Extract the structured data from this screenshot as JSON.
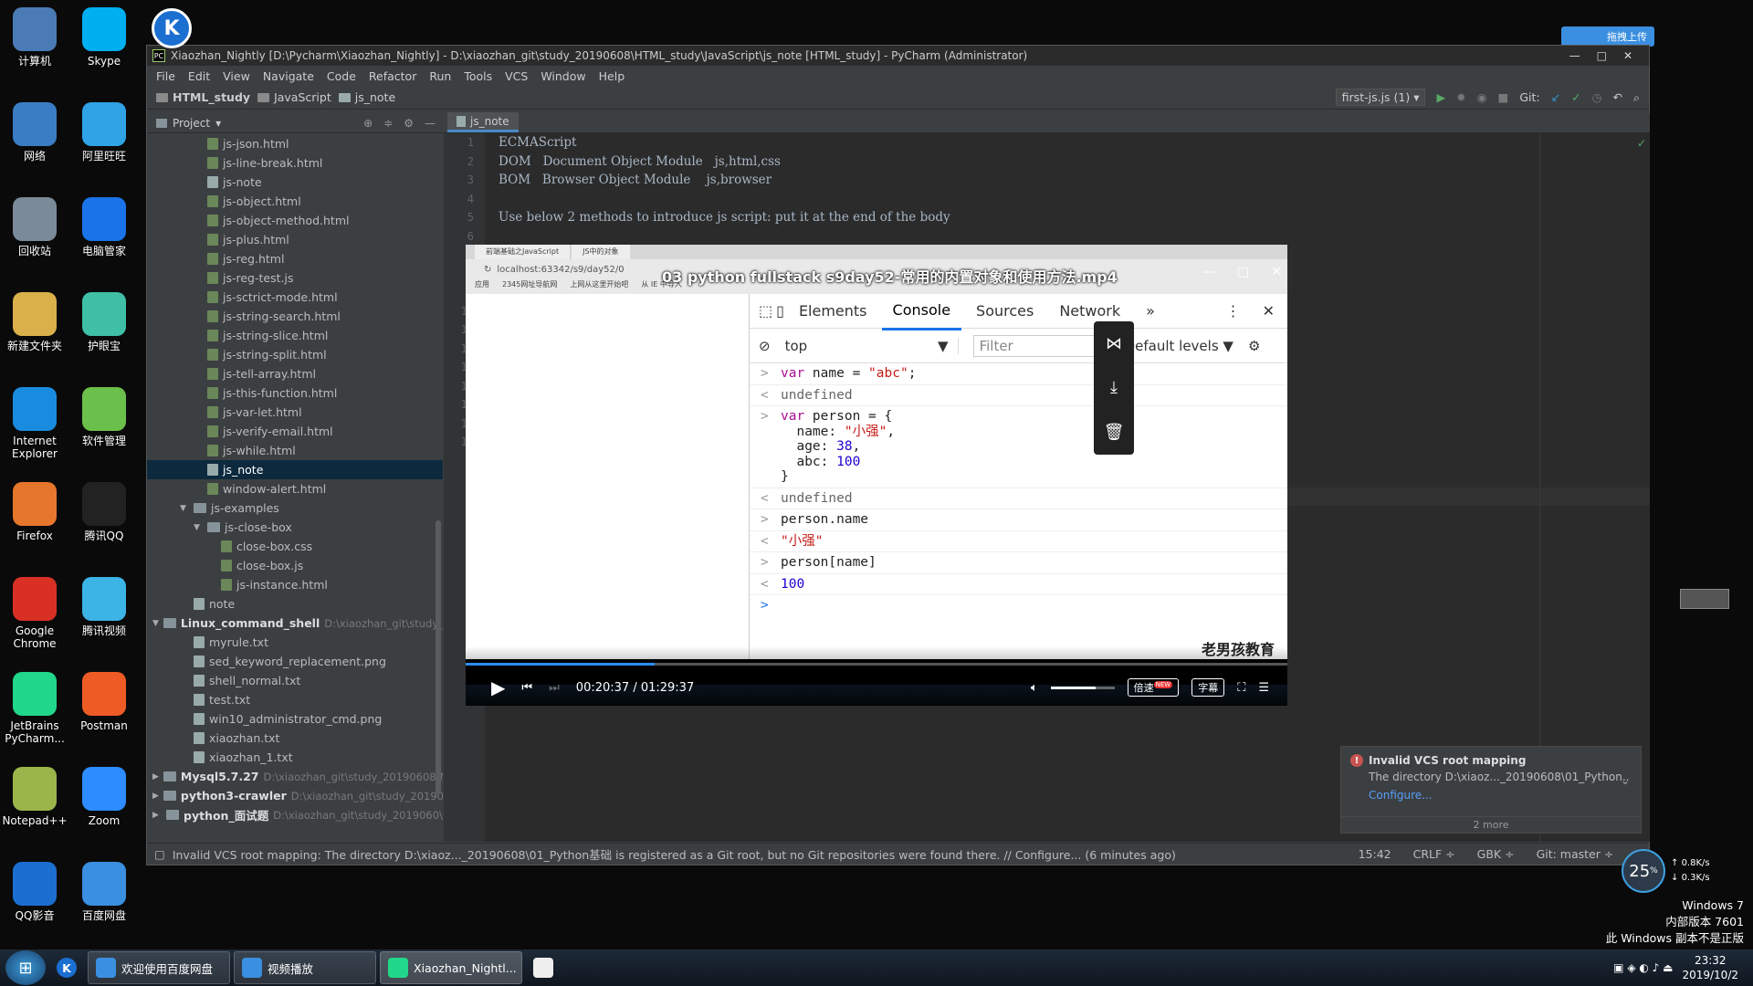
{
  "desktop": {
    "icons": [
      {
        "label": "计算机",
        "icon": "computer-icon",
        "color": "#4a7bb5"
      },
      {
        "label": "Skype",
        "icon": "skype-icon",
        "color": "#00aff0"
      },
      {
        "label": "网络",
        "icon": "network-icon",
        "color": "#3b7dc4"
      },
      {
        "label": "阿里旺旺",
        "icon": "aliwangwang-icon",
        "color": "#2fa3e6"
      },
      {
        "label": "回收站",
        "icon": "recycle-bin-icon",
        "color": "#7a8a99"
      },
      {
        "label": "电脑管家",
        "icon": "pc-manager-icon",
        "color": "#1a73e8"
      },
      {
        "label": "新建文件夹",
        "icon": "folder-icon",
        "color": "#d9b04a"
      },
      {
        "label": "护眼宝",
        "icon": "eye-care-icon",
        "color": "#3fbfa6"
      },
      {
        "label": "Internet Explorer",
        "icon": "ie-icon",
        "color": "#1a8ce0"
      },
      {
        "label": "软件管理",
        "icon": "software-manager-icon",
        "color": "#6bc04b"
      },
      {
        "label": "Firefox",
        "icon": "firefox-icon",
        "color": "#e6762c"
      },
      {
        "label": "腾讯QQ",
        "icon": "qq-icon",
        "color": "#222222"
      },
      {
        "label": "Google Chrome",
        "icon": "chrome-icon",
        "color": "#d93025"
      },
      {
        "label": "腾讯视频",
        "icon": "tencent-video-icon",
        "color": "#3cb4e5"
      },
      {
        "label": "JetBrains PyCharm...",
        "icon": "pycharm-icon",
        "color": "#21d789"
      },
      {
        "label": "Postman",
        "icon": "postman-icon",
        "color": "#ef5b25"
      },
      {
        "label": "Notepad++",
        "icon": "notepadpp-icon",
        "color": "#9ab54a"
      },
      {
        "label": "Zoom",
        "icon": "zoom-icon",
        "color": "#2d8cff"
      },
      {
        "label": "QQ影音",
        "icon": "qq-player-icon",
        "color": "#1b6fd1"
      },
      {
        "label": "百度网盘",
        "icon": "baidu-netdisk-icon",
        "color": "#3b8fe0"
      }
    ],
    "top_k_icon": "K",
    "baidu_upload": "拖拽上传"
  },
  "ide": {
    "title": "Xiaozhan_Nightly [D:\\Pycharm\\Xiaozhan_Nightly] - D:\\xiaozhan_git\\study_20190608\\HTML_study\\JavaScript\\js_note [HTML_study] - PyCharm (Administrator)",
    "menu": [
      "File",
      "Edit",
      "View",
      "Navigate",
      "Code",
      "Refactor",
      "Run",
      "Tools",
      "VCS",
      "Window",
      "Help"
    ],
    "breadcrumb": [
      "HTML_study",
      "JavaScript",
      "js_note"
    ],
    "run_config": "first-js.js (1)",
    "git_label": "Git:",
    "project_label": "Project",
    "tree": [
      {
        "name": "js-json.html",
        "indent": 3,
        "kind": "file"
      },
      {
        "name": "js-line-break.html",
        "indent": 3,
        "kind": "file"
      },
      {
        "name": "js-note",
        "indent": 3,
        "kind": "txt"
      },
      {
        "name": "js-object.html",
        "indent": 3,
        "kind": "file"
      },
      {
        "name": "js-object-method.html",
        "indent": 3,
        "kind": "file"
      },
      {
        "name": "js-plus.html",
        "indent": 3,
        "kind": "file"
      },
      {
        "name": "js-reg.html",
        "indent": 3,
        "kind": "file"
      },
      {
        "name": "js-reg-test.js",
        "indent": 3,
        "kind": "file"
      },
      {
        "name": "js-sctrict-mode.html",
        "indent": 3,
        "kind": "file"
      },
      {
        "name": "js-string-search.html",
        "indent": 3,
        "kind": "file"
      },
      {
        "name": "js-string-slice.html",
        "indent": 3,
        "kind": "file"
      },
      {
        "name": "js-string-split.html",
        "indent": 3,
        "kind": "file"
      },
      {
        "name": "js-tell-array.html",
        "indent": 3,
        "kind": "file"
      },
      {
        "name": "js-this-function.html",
        "indent": 3,
        "kind": "file"
      },
      {
        "name": "js-var-let.html",
        "indent": 3,
        "kind": "file"
      },
      {
        "name": "js-verify-email.html",
        "indent": 3,
        "kind": "file"
      },
      {
        "name": "js-while.html",
        "indent": 3,
        "kind": "file"
      },
      {
        "name": "js_note",
        "indent": 3,
        "kind": "txt",
        "selected": true
      },
      {
        "name": "window-alert.html",
        "indent": 3,
        "kind": "file"
      },
      {
        "name": "js-examples",
        "indent": 2,
        "kind": "folder",
        "arrow": "▼"
      },
      {
        "name": "js-close-box",
        "indent": 3,
        "kind": "folder",
        "arrow": "▼"
      },
      {
        "name": "close-box.css",
        "indent": 4,
        "kind": "file"
      },
      {
        "name": "close-box.js",
        "indent": 4,
        "kind": "file"
      },
      {
        "name": "js-instance.html",
        "indent": 4,
        "kind": "file"
      },
      {
        "name": "note",
        "indent": 2,
        "kind": "txt"
      },
      {
        "name": "Linux_command_shell",
        "indent": 0,
        "kind": "folder",
        "arrow": "▼",
        "bold": true,
        "path": "D:\\xiaozhan_git\\study_20"
      },
      {
        "name": "myrule.txt",
        "indent": 2,
        "kind": "txt"
      },
      {
        "name": "sed_keyword_replacement.png",
        "indent": 2,
        "kind": "txt"
      },
      {
        "name": "shell_normal.txt",
        "indent": 2,
        "kind": "txt"
      },
      {
        "name": "test.txt",
        "indent": 2,
        "kind": "txt"
      },
      {
        "name": "win10_administrator_cmd.png",
        "indent": 2,
        "kind": "txt"
      },
      {
        "name": "xiaozhan.txt",
        "indent": 2,
        "kind": "txt"
      },
      {
        "name": "xiaozhan_1.txt",
        "indent": 2,
        "kind": "txt"
      },
      {
        "name": "Mysql5.7.27",
        "indent": 0,
        "kind": "folder",
        "arrow": "▶",
        "bold": true,
        "path": "D:\\xiaozhan_git\\study_20190608\\My"
      },
      {
        "name": "python3-crawler",
        "indent": 0,
        "kind": "folder",
        "arrow": "▶",
        "bold": true,
        "path": "D:\\xiaozhan_git\\study_2019060"
      },
      {
        "name": "python_面试题",
        "indent": 0,
        "kind": "folder",
        "arrow": "▶",
        "bold": true,
        "path": "D:\\xiaozhan_git\\study_2019060\\"
      }
    ],
    "tab": "js_note",
    "code_lines": [
      "ECMAScript",
      "DOM   Document Object Module   js,html,css",
      "BOM   Browser Object Module    js,browser",
      "",
      "Use below 2 methods to introduce js script: put it at the end of the body",
      "",
      "",
      "",
      "",
      "",
      "",
      "",
      "",
      "",
      "",
      "",
      ""
    ],
    "line_numbers": [
      "1",
      "2",
      "3",
      "4",
      "5",
      "6",
      "7",
      "8",
      "9",
      "10",
      "11",
      "12",
      "13",
      "14",
      "15",
      "16",
      "17"
    ],
    "status_msg": "Invalid VCS root mapping: The directory D:\\xiaoz..._20190608\\01_Python基础 is registered as a Git root, but no Git repositories were found there. // Configure... (6 minutes ago)",
    "status_pos": "15:42",
    "status_crlf": "CRLF ÷",
    "status_enc": "GBK ÷",
    "status_git": "Git: master ÷",
    "notification": {
      "title": "Invalid VCS root mapping",
      "body": "The directory D:\\xiaoz..._20190608\\01_Python..",
      "link": "Configure...",
      "more": "2 more"
    }
  },
  "video": {
    "title": "03 python fullstack s9day52-常用的内置对象和使用方法.mp4",
    "browser_tabs": [
      "前端基础之JavaScript",
      "JS中的对象"
    ],
    "url": "localhost:63342/s9/day52/0",
    "bookmarks": [
      "应用",
      "2345网址导航网",
      "上网从这里开始吧",
      "从 IE 中导入"
    ],
    "devtools_tabs": [
      "Elements",
      "Console",
      "Sources",
      "Network",
      "»"
    ],
    "context": "top",
    "filter_placeholder": "Filter",
    "levels": "Default levels ▼",
    "time": "00:20:37 / 01:29:37",
    "progress": 0.23,
    "volume": 0.7,
    "speed_label": "倍速",
    "new_badge": "NEW",
    "subtitle_label": "字幕",
    "watermark": "老男孩教育"
  },
  "taskbar": {
    "items": [
      {
        "label": "欢迎使用百度网盘",
        "icon": "baidu-netdisk-icon",
        "color": "#3b8fe0"
      },
      {
        "label": "视频播放",
        "icon": "baidu-netdisk-icon",
        "color": "#3b8fe0"
      },
      {
        "label": "Xiaozhan_Nightl...",
        "icon": "pycharm-icon",
        "color": "#21d789"
      }
    ],
    "time": "23:32",
    "date": "2019/10/2",
    "net_percent": "25",
    "net_up": "0.8K/s",
    "net_down": "0.3K/s",
    "winver": [
      "Windows 7",
      "内部版本 7601",
      "此 Windows 副本不是正版"
    ]
  }
}
